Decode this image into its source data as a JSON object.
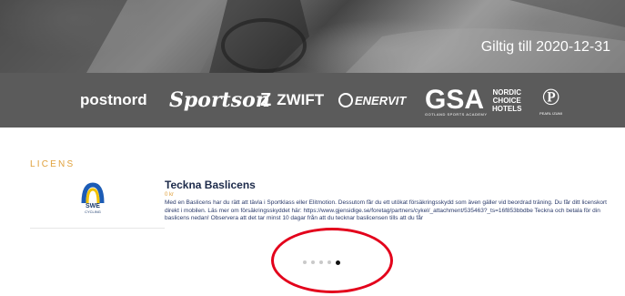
{
  "hero": {
    "valid_until": "Giltig till 2020-12-31"
  },
  "sponsors": {
    "postnord": "postnord",
    "sportson": "Sportson",
    "zwift": "ZWIFT",
    "enervit": "ENERVIT",
    "gsa": "GSA",
    "gsa_sub": "GOTLAND SPORTS ACADEMY",
    "nordic": [
      "NORDIC",
      "CHOICE",
      "HOTELS"
    ],
    "pearl_sub": "PEARL IZUMI"
  },
  "section": {
    "label": "LICENS"
  },
  "license_card": {
    "logo_text": "SWE",
    "logo_sub": "CYCLING",
    "title": "Teckna Baslicens",
    "subtitle": "0 kr",
    "body_before_link": "Med en Baslicens har du rätt att tävla i Sportklass eller Elitmotion. Dessutom får du ett utökat försäkringsskydd som även gäller vid beordrad träning. Du får ditt licenskort direkt i mobilen. Läs mer om försäkringsskyddet här: ",
    "link": "https://www.gjensidige.se/foretag/partners/cykel/_attachment/535463?_ts=16f853bbdbe",
    "body_after_link": " Teckna och betala för din baslicens nedan! Observera att det tar minst 10 dagar från att du tecknar baslicensen tills att du får"
  },
  "pagination": {
    "count": 5,
    "active_index": 4
  },
  "colors": {
    "sponsor_band": "#5b5b5b",
    "accent": "#e0a13c",
    "title": "#1c2a4a",
    "highlight_circle": "#e3001b"
  },
  "icons": [
    "swe-cycling-logo",
    "zwift-z-icon",
    "enervit-icon",
    "pearl-izumi-icon"
  ]
}
